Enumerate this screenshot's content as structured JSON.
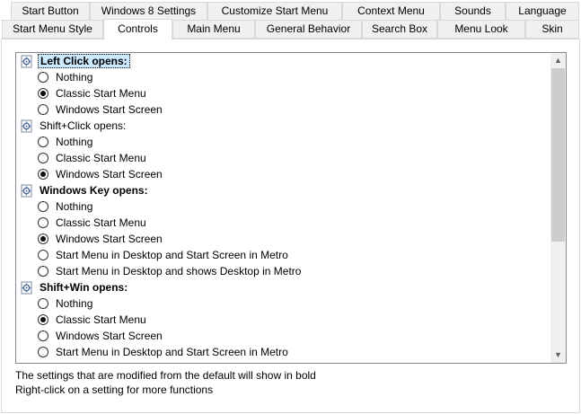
{
  "tabs_row1": [
    {
      "label": "Start Button"
    },
    {
      "label": "Windows 8 Settings"
    },
    {
      "label": "Customize Start Menu"
    },
    {
      "label": "Context Menu"
    },
    {
      "label": "Sounds"
    },
    {
      "label": "Language"
    }
  ],
  "tabs_row2": [
    {
      "label": "Start Menu Style"
    },
    {
      "label": "Controls",
      "active": true
    },
    {
      "label": "Main Menu"
    },
    {
      "label": "General Behavior"
    },
    {
      "label": "Search Box"
    },
    {
      "label": "Menu Look"
    },
    {
      "label": "Skin"
    }
  ],
  "settings": [
    {
      "label": "Left Click opens:",
      "bold": true,
      "selected": true,
      "options": [
        {
          "label": "Nothing",
          "checked": false
        },
        {
          "label": "Classic Start Menu",
          "checked": true
        },
        {
          "label": "Windows Start Screen",
          "checked": false
        }
      ]
    },
    {
      "label": "Shift+Click opens:",
      "bold": false,
      "selected": false,
      "options": [
        {
          "label": "Nothing",
          "checked": false
        },
        {
          "label": "Classic Start Menu",
          "checked": false
        },
        {
          "label": "Windows Start Screen",
          "checked": true
        }
      ]
    },
    {
      "label": "Windows Key opens:",
      "bold": true,
      "selected": false,
      "options": [
        {
          "label": "Nothing",
          "checked": false
        },
        {
          "label": "Classic Start Menu",
          "checked": false
        },
        {
          "label": "Windows Start Screen",
          "checked": true
        },
        {
          "label": "Start Menu in Desktop and Start Screen in Metro",
          "checked": false
        },
        {
          "label": "Start Menu in Desktop and shows Desktop in Metro",
          "checked": false
        }
      ]
    },
    {
      "label": "Shift+Win opens:",
      "bold": true,
      "selected": false,
      "options": [
        {
          "label": "Nothing",
          "checked": false
        },
        {
          "label": "Classic Start Menu",
          "checked": true
        },
        {
          "label": "Windows Start Screen",
          "checked": false
        },
        {
          "label": "Start Menu in Desktop and Start Screen in Metro",
          "checked": false
        }
      ]
    }
  ],
  "footer": {
    "line1": "The settings that are modified from the default will show in bold",
    "line2": "Right-click on a setting for more functions"
  },
  "icons": {
    "group": "gear-settings-icon",
    "scroll_up": "scroll-up-arrow-icon",
    "scroll_down": "scroll-down-arrow-icon"
  },
  "scroll_up_glyph": "▲",
  "scroll_down_glyph": "▼"
}
